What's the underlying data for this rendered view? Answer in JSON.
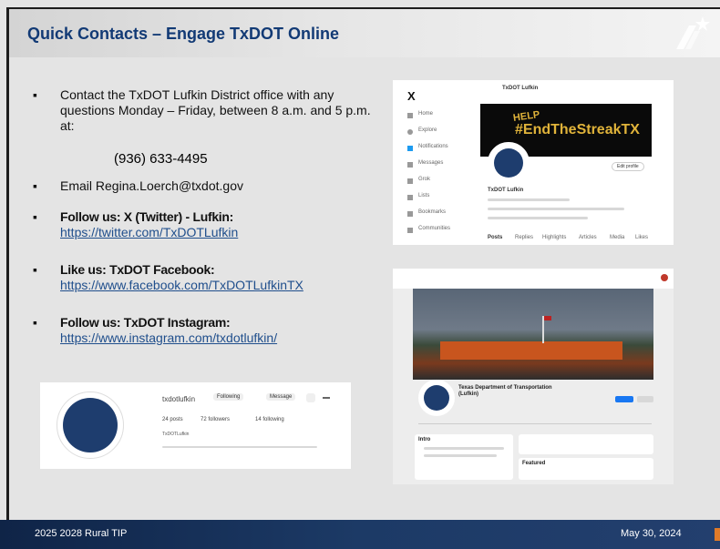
{
  "slide": {
    "title": "Quick Contacts – Engage TxDOT Online",
    "footer_left": "2025 2028 Rural TIP",
    "footer_right": "May 30, 2024"
  },
  "bullets": {
    "marker": "▪",
    "contact_text": "Contact the TxDOT Lufkin District office with any questions Monday – Friday, between 8 a.m. and 5 p.m. at:",
    "phone": "(936) 633-4495",
    "email_text": "Email Regina.Loerch@txdot.gov",
    "twitter_heading": "Follow us: X (Twitter) - Lufkin:",
    "twitter_url": "https://twitter.com/TxDOTLufkin",
    "facebook_heading": "Like us: TxDOT Facebook:",
    "facebook_url": "https://www.facebook.com/TxDOTLufkinTX",
    "instagram_heading": "Follow us: TxDOT Instagram:",
    "instagram_url": "https://www.instagram.com/txdotlufkin/"
  },
  "x_screenshot": {
    "logo": "X",
    "profile_name": "TxDOT Lufkin",
    "banner_text": "#EndTheStreakTX",
    "banner_help": "HELP",
    "edit_button": "Edit profile",
    "nav_items": [
      "Home",
      "Explore",
      "Notifications",
      "Messages",
      "Grok",
      "Lists",
      "Bookmarks",
      "Communities"
    ],
    "tabs": [
      "Posts",
      "Replies",
      "Highlights",
      "Articles",
      "Media",
      "Likes"
    ]
  },
  "facebook_screenshot": {
    "page_name": "Texas Department of Transportation (Lufkin)",
    "sections": [
      "Intro",
      "Featured"
    ]
  },
  "instagram_screenshot": {
    "handle": "txdotlufkin",
    "following_button": "Following",
    "message_button": "Message",
    "posts": "24 posts",
    "followers": "72 followers",
    "following": "14 following",
    "name": "TxDOTLufkin"
  }
}
